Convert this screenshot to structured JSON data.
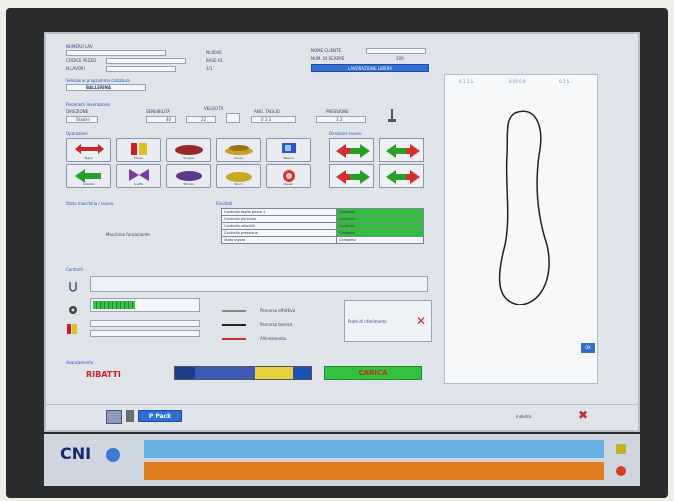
{
  "header": {
    "fields": [
      {
        "label": "NUMERO LAV.",
        "value": "Nr.0046"
      },
      {
        "label": "CODICE PEZZO",
        "value": "BASE-01"
      },
      {
        "label": "N.LAVORI",
        "value": "1/1"
      }
    ],
    "right_fields": [
      {
        "label": "NOME CLIENTE",
        "value": ""
      },
      {
        "label": "NUM. DI SCARPE",
        "value": "100"
      }
    ],
    "status_button": "LAVORAZIONE LIBERA"
  },
  "sections": {
    "selection": "Selezione programma calzatura",
    "selection_value": "BALLERINA",
    "parameters": "Parametri lavorazione",
    "params": [
      {
        "label": "DIREZIONE",
        "value": "Stabile"
      },
      {
        "label": "SENSIBILITÀ",
        "value": "40"
      },
      {
        "label": "VELOCITÀ",
        "value": "22"
      },
      {
        "label": "ANG. TAGLIO",
        "value": "0.1 2"
      },
      {
        "label": "PRESSIONE",
        "value": "3.2"
      }
    ],
    "operations": "Operazioni",
    "direction": "Direzione lavoro",
    "status": "Stato macchina / lavoro",
    "progress_label": "Avanzamento",
    "controls": "Controlli",
    "result": "Risultati",
    "legend_title": "Rilevazione percorso"
  },
  "tools": [
    {
      "name": "cutter-tool-icon",
      "caption": "Taglio"
    },
    {
      "name": "clamp-tool-icon",
      "caption": "Morsa"
    },
    {
      "name": "shoe-red-icon",
      "caption": "Scarpa"
    },
    {
      "name": "shoe-yellow-icon",
      "caption": "Suola"
    },
    {
      "name": "measure-tool-icon",
      "caption": "Misura"
    },
    {
      "name": "move-left-icon",
      "caption": "Sinistra"
    },
    {
      "name": "stapler-icon",
      "caption": "Graffa"
    },
    {
      "name": "shoe-purple-icon",
      "caption": "Tomaia"
    },
    {
      "name": "shoe-yellow2-icon",
      "caption": "Tacco"
    },
    {
      "name": "reset-icon",
      "caption": "Reset"
    }
  ],
  "table": {
    "rows": [
      [
        "Controllo taglio pezzo 1",
        "Controllo"
      ],
      [
        "Controllo percorso",
        "Controllo"
      ],
      [
        "Controllo velocità",
        "Controllo"
      ],
      [
        "Controllo pressione",
        "Controllo"
      ],
      [
        "Stato lavoro",
        "Completo"
      ]
    ]
  },
  "middle_text": "Macchina funzionante",
  "legend": [
    {
      "label": "Percorso effettivo",
      "color": "#888888"
    },
    {
      "label": "Percorso teorico",
      "color": "#222222"
    },
    {
      "label": "Allineamento",
      "color": "#c83232"
    }
  ],
  "side_panel_label": "Punti di riferimento",
  "progress": 0.4,
  "scrap_label": "RIBATTI",
  "clear_label": "CARICA",
  "color_bar_colors": [
    "#1e3c8c",
    "#3c5ab4",
    "#e6d23c",
    "#1e50b4"
  ],
  "right_panel": {
    "tabs": [
      "0.1 3.5",
      "0.50 0.9",
      "0.1 5"
    ],
    "ok_button": "OK"
  },
  "bottom_bar": {
    "brand_button": "P Pack",
    "right_text": "Indietro"
  },
  "taskbar": {
    "logo": "CNI",
    "colors": {
      "blue": "#66b0e3",
      "orange": "#e07c1f"
    }
  }
}
